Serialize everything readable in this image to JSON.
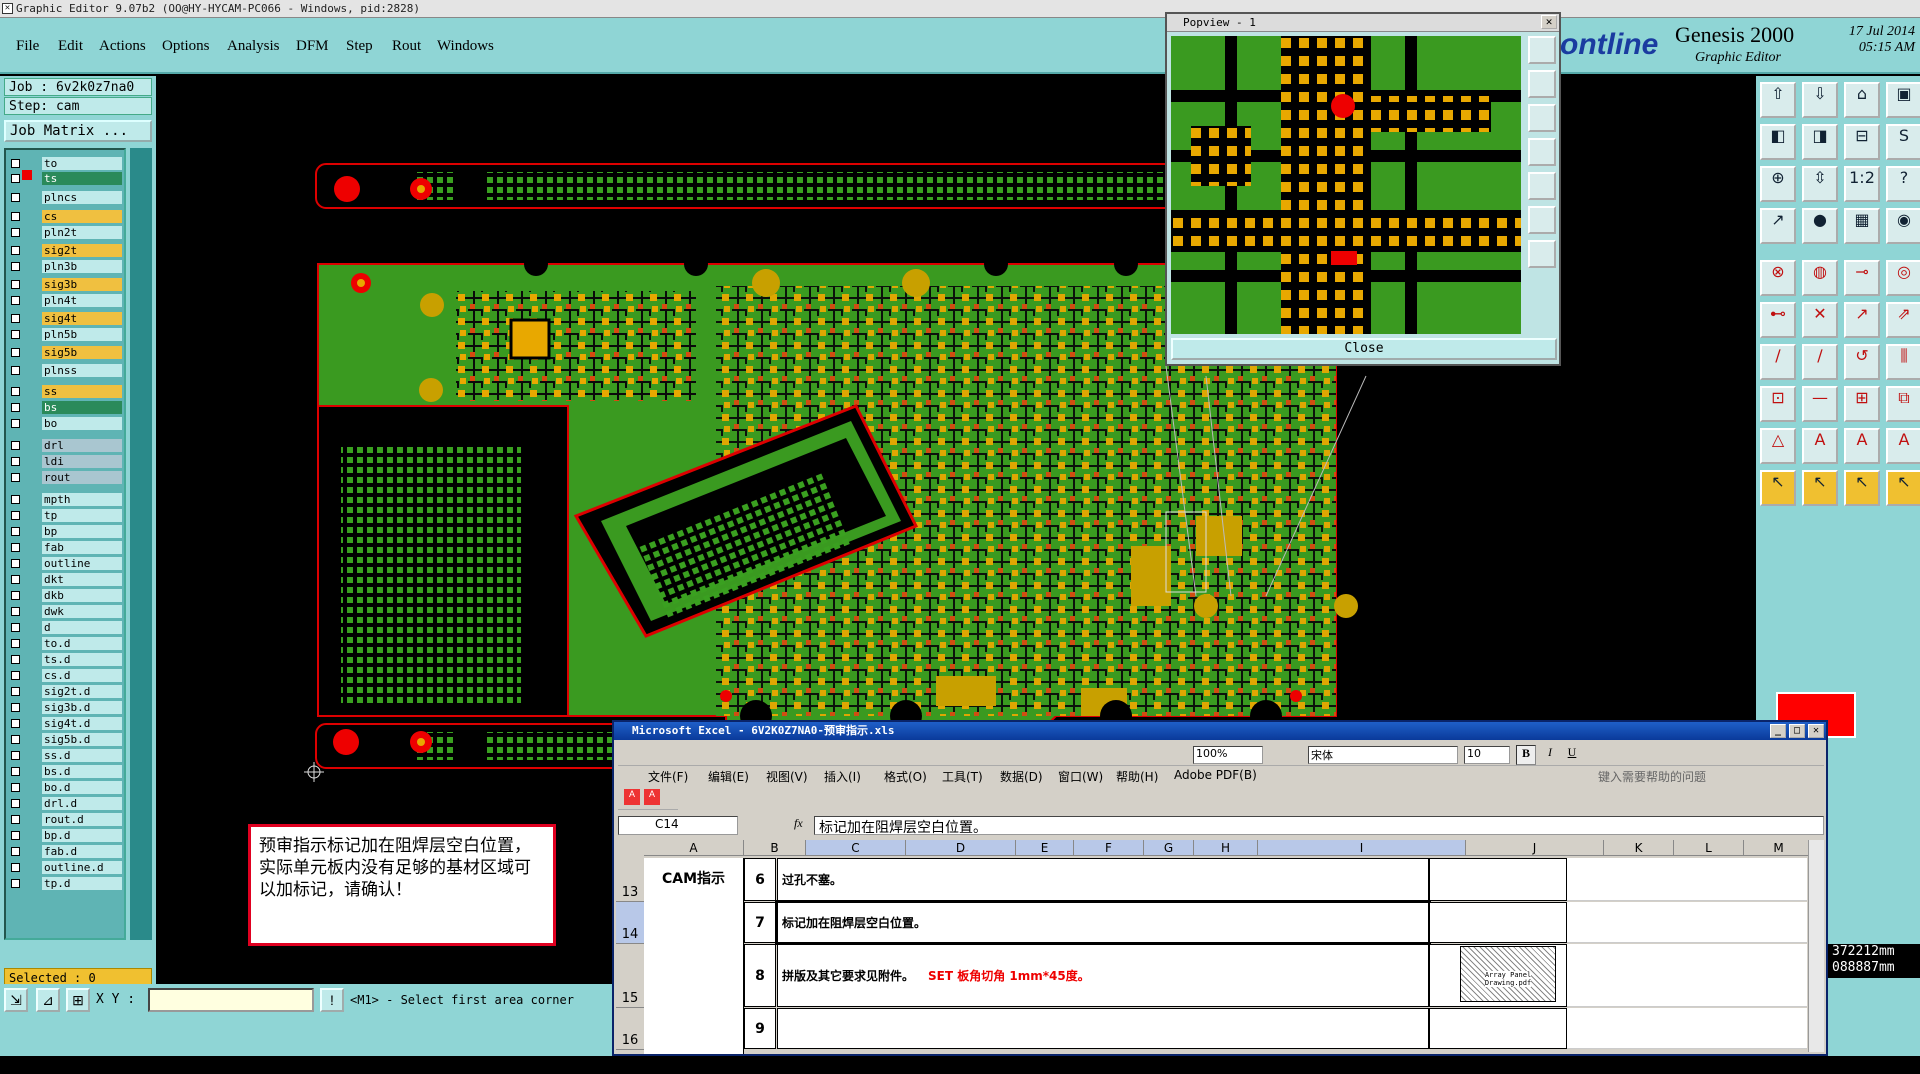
{
  "window": {
    "title": "Graphic Editor 9.07b2 (OO@HY-HYCAM-PC066 - Windows, pid:2828)"
  },
  "menu": {
    "items": [
      "File",
      "Edit",
      "Actions",
      "Options",
      "Analysis",
      "DFM",
      "Step",
      "Rout",
      "Windows"
    ]
  },
  "brand": {
    "logo": "ontline",
    "product": "Genesis 2000",
    "subtitle": "Graphic Editor",
    "date": "17 Jul 2014",
    "time": "05:15 AM"
  },
  "job": {
    "job_label": "Job : 6v2k0z7na0",
    "step_label": "Step: cam",
    "matrix_button": "Job Matrix ..."
  },
  "layers": [
    "to",
    "ts",
    "plncs",
    "cs",
    "pln2t",
    "sig2t",
    "pln3b",
    "sig3b",
    "pln4t",
    "sig4t",
    "pln5b",
    "sig5b",
    "plnss",
    "ss",
    "bs",
    "bo",
    "drl",
    "ldi",
    "rout",
    "mpth",
    "tp",
    "bp",
    "fab",
    "outline",
    "dkt",
    "dkb",
    "dwk",
    "d",
    "to.d",
    "ts.d",
    "cs.d",
    "sig2t.d",
    "sig3b.d",
    "sig4t.d",
    "sig5b.d",
    "ss.d",
    "bs.d",
    "bo.d",
    "drl.d",
    "rout.d",
    "bp.d",
    "fab.d",
    "outline.d",
    "tp.d"
  ],
  "layer_colors": {
    "ts": "#2a8a5a",
    "cs": "#f0c040",
    "sig2t": "#f0c040",
    "sig3b": "#f0c040",
    "sig4t": "#f0c040",
    "sig5b": "#f0c040",
    "ss": "#f0c040",
    "bs": "#2a8a5a",
    "drl": "#a9c6d0",
    "ldi": "#a9c6d0",
    "rout": "#a9c6d0"
  },
  "selected": "Selected : 0",
  "bottom": {
    "xy_label": "X Y :",
    "xy_value": "",
    "status": "<M1> - Select first area corner"
  },
  "popview": {
    "title": "Popview - 1",
    "close_label": "Close"
  },
  "coords": {
    "x": "372212mm",
    "y": "088887mm",
    "units": "MM"
  },
  "note": {
    "text": "预审指示标记加在阻焊层空白位置，实际单元板内没有足够的基材区域可以加标记，请确认！"
  },
  "excel": {
    "title": "Microsoft Excel - 6V2K0Z7NA0-预审指示.xls",
    "menu": [
      "文件(F)",
      "编辑(E)",
      "视图(V)",
      "插入(I)",
      "格式(O)",
      "工具(T)",
      "数据(D)",
      "窗口(W)",
      "帮助(H)",
      "Adobe PDF(B)"
    ],
    "help_placeholder": "键入需要帮助的问题",
    "zoom": "100%",
    "font": "宋体",
    "font_size": "10",
    "name_box": "C14",
    "formula": "标记加在阻焊层空白位置。",
    "columns": [
      "A",
      "B",
      "C",
      "D",
      "E",
      "F",
      "G",
      "H",
      "I",
      "J",
      "K",
      "L",
      "M"
    ],
    "rows": [
      {
        "num": "13",
        "b": "6",
        "c": "过孔不塞。",
        "red": ""
      },
      {
        "num": "14",
        "b": "7",
        "c": "标记加在阻焊层空白位置。",
        "red": ""
      },
      {
        "num": "15",
        "b": "8",
        "c": "拼版及其它要求见附件。",
        "red": "SET 板角切角 1mm*45度。"
      },
      {
        "num": "16",
        "b": "9",
        "c": "",
        "red": ""
      }
    ],
    "a_label": "CAM指示",
    "attachment": "Array Panel Drawing.pdf"
  }
}
